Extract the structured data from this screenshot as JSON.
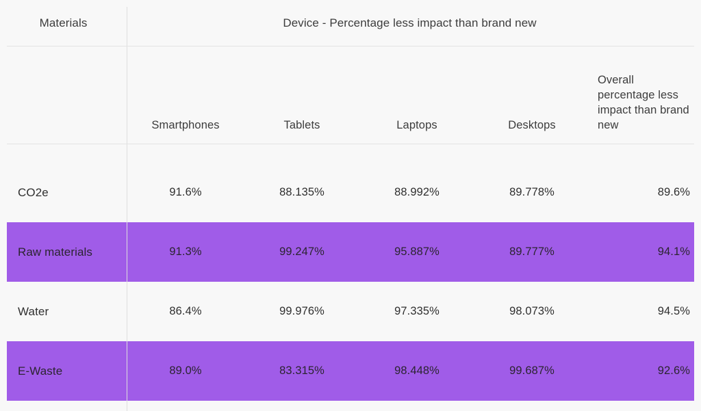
{
  "colors": {
    "page_background": "#f8f8f8",
    "highlight_row": "#a05ce8",
    "rule": "#e3e3e3",
    "text": "#3a3a3a"
  },
  "table": {
    "corner_header": "Materials",
    "group_header": "Device - Percentage less impact than brand new",
    "column_headers": [
      "Smartphones",
      "Tablets",
      "Laptops",
      "Desktops",
      "Overall percentage less impact than brand new"
    ],
    "rows": [
      {
        "label": "CO2e",
        "highlighted": false,
        "values": [
          "91.6%",
          "88.135%",
          "88.992%",
          "89.778%"
        ],
        "overall": "89.6%"
      },
      {
        "label": "Raw materials",
        "highlighted": true,
        "values": [
          "91.3%",
          "99.247%",
          "95.887%",
          "89.777%"
        ],
        "overall": "94.1%"
      },
      {
        "label": "Water",
        "highlighted": false,
        "values": [
          "86.4%",
          "99.976%",
          "97.335%",
          "98.073%"
        ],
        "overall": "94.5%"
      },
      {
        "label": "E-Waste",
        "highlighted": true,
        "values": [
          "89.0%",
          "83.315%",
          "98.448%",
          "99.687%"
        ],
        "overall": "92.6%"
      }
    ]
  },
  "chart_data": {
    "type": "table",
    "title": "Device - Percentage less impact than brand new",
    "row_axis_label": "Materials",
    "categories": [
      "Smartphones",
      "Tablets",
      "Laptops",
      "Desktops"
    ],
    "extra_column": "Overall percentage less impact than brand new",
    "series": [
      {
        "name": "CO2e",
        "values": [
          91.6,
          88.135,
          88.992,
          89.778
        ],
        "overall": 89.6
      },
      {
        "name": "Raw materials",
        "values": [
          91.3,
          99.247,
          95.887,
          89.777
        ],
        "overall": 94.1
      },
      {
        "name": "Water",
        "values": [
          86.4,
          99.976,
          97.335,
          98.073
        ],
        "overall": 94.5
      },
      {
        "name": "E-Waste",
        "values": [
          89.0,
          83.315,
          98.448,
          99.687
        ],
        "overall": 92.6
      }
    ],
    "units": "percent"
  }
}
